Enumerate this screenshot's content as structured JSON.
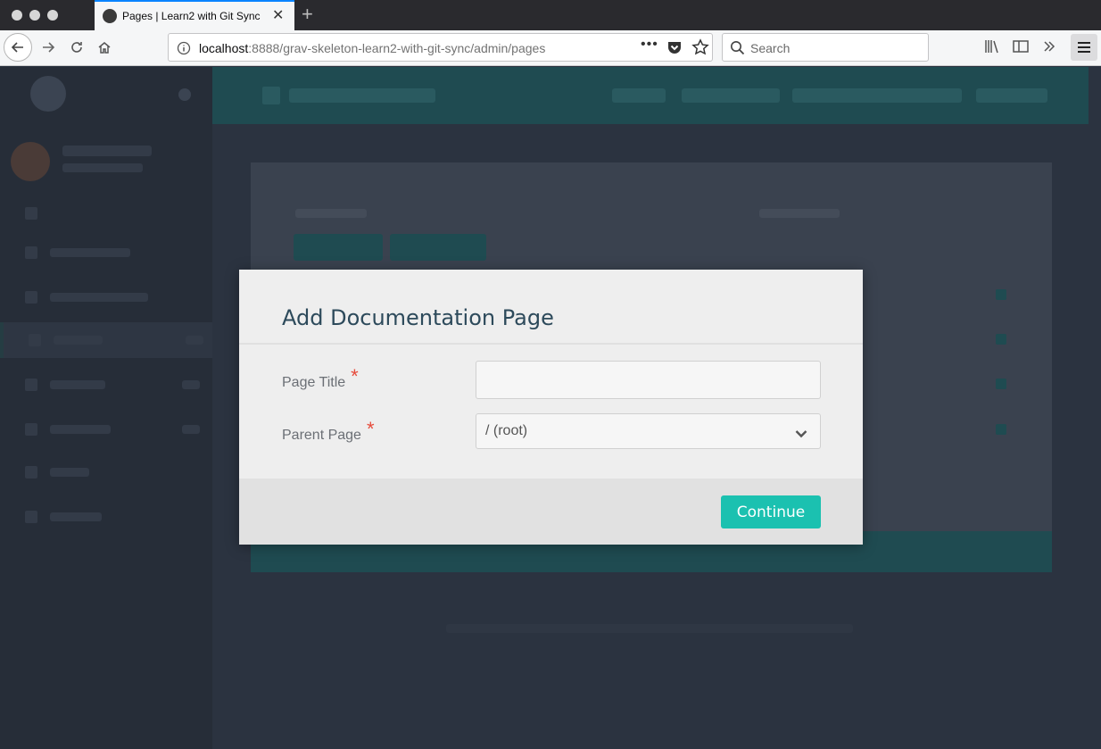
{
  "browser": {
    "tab": {
      "title": "Pages | Learn2 with Git Sync",
      "favicon": "grav-favicon-icon"
    },
    "url": {
      "host": "localhost",
      "path": ":8888/grav-skeleton-learn2-with-git-sync/admin/pages"
    },
    "search": {
      "placeholder": "Search"
    },
    "icons": [
      "back-icon",
      "forward-icon",
      "reload-icon",
      "home-icon",
      "info-icon",
      "more-icon",
      "pocket-icon",
      "bookmark-star-icon",
      "search-icon",
      "library-icon",
      "sidebar-icon",
      "overflow-icon",
      "menu-icon"
    ]
  },
  "modal": {
    "title": "Add Documentation Page",
    "fields": {
      "page_title": {
        "label": "Page Title",
        "required_mark": "*",
        "value": ""
      },
      "parent_page": {
        "label": "Parent Page",
        "required_mark": "*",
        "selected": "/ (root)"
      }
    },
    "continue_label": "Continue"
  },
  "colors": {
    "accent": "#1bc1b0",
    "title": "#2d4a5b",
    "required": "#e64b3b",
    "overlay_bg": "#2b3340",
    "tab_highlight": "#0a84ff"
  }
}
